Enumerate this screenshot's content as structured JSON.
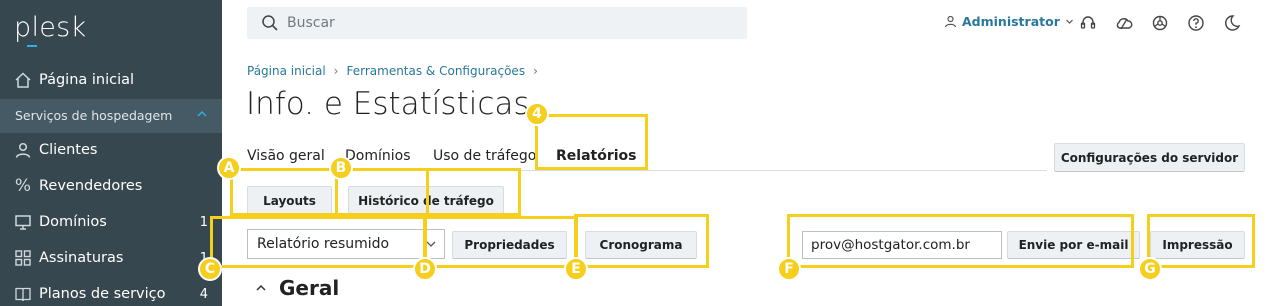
{
  "sidebar": {
    "logo": "plesk",
    "home": "Página inicial",
    "section": "Serviços de hospedagem",
    "items": [
      {
        "label": "Clientes",
        "icon": "user-icon",
        "count": ""
      },
      {
        "label": "Revendedores",
        "icon": "percent-icon",
        "count": ""
      },
      {
        "label": "Domínios",
        "icon": "monitor-icon",
        "count": "1"
      },
      {
        "label": "Assinaturas",
        "icon": "grid-icon",
        "count": "1"
      },
      {
        "label": "Planos de serviço",
        "icon": "book-icon",
        "count": "4"
      }
    ]
  },
  "header": {
    "search_placeholder": "Buscar",
    "user": "Administrator"
  },
  "breadcrumb": [
    "Página inicial",
    "Ferramentas & Configurações"
  ],
  "page_title": "Info. e Estatísticas",
  "tabs": [
    "Visão geral",
    "Domínios",
    "Uso de tráfego",
    "Relatórios"
  ],
  "active_tab": "Relatórios",
  "buttons": {
    "server_settings": "Configurações do servidor",
    "layouts": "Layouts",
    "traffic_history": "Histórico de tráfego",
    "properties": "Propriedades",
    "schedule": "Cronograma",
    "send_email": "Envie por e-mail",
    "print": "Impressão"
  },
  "report_select": "Relatório resumido",
  "email_value": "prov@hostgator.com.br",
  "section_title": "Geral",
  "markers": {
    "m4": "4",
    "A": "A",
    "B": "B",
    "C": "C",
    "D": "D",
    "E": "E",
    "F": "F",
    "G": "G"
  },
  "colors": {
    "sidebar": "#37474f",
    "link": "#28789c",
    "highlight": "#f5cf1b"
  }
}
